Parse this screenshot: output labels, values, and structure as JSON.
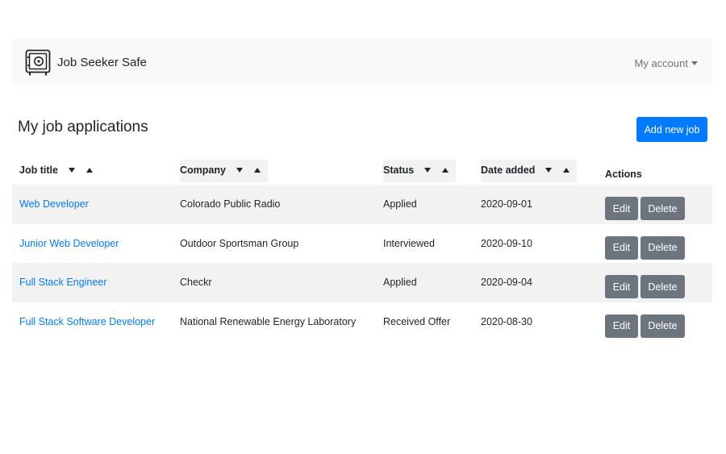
{
  "navbar": {
    "brand": "Job Seeker Safe",
    "account": "My account"
  },
  "page": {
    "title": "My job applications",
    "add_button": "Add new job"
  },
  "table": {
    "headers": {
      "job_title": "Job title",
      "company": "Company",
      "status": "Status",
      "date_added": "Date added",
      "actions": "Actions"
    },
    "edit_label": "Edit",
    "delete_label": "Delete",
    "rows": [
      {
        "title": "Web Developer",
        "company": "Colorado Public Radio",
        "status": "Applied",
        "date": "2020-09-01"
      },
      {
        "title": "Junior Web Developer",
        "company": "Outdoor Sportsman Group",
        "status": "Interviewed",
        "date": "2020-09-10"
      },
      {
        "title": "Full Stack Engineer",
        "company": "Checkr",
        "status": "Applied",
        "date": "2020-09-04"
      },
      {
        "title": "Full Stack Software Developer",
        "company": "National Renewable Energy Laboratory",
        "status": "Received Offer",
        "date": "2020-08-30"
      }
    ]
  },
  "icons": {
    "brand": "safe-icon",
    "account_menu": "caret-down-icon",
    "sort_desc": "sort-down-icon",
    "sort_asc": "sort-up-icon"
  },
  "colors": {
    "primary": "#007bff",
    "secondary": "#6c757d",
    "navbar_bg": "#f8f9fa",
    "stripe": "#f2f2f2"
  }
}
